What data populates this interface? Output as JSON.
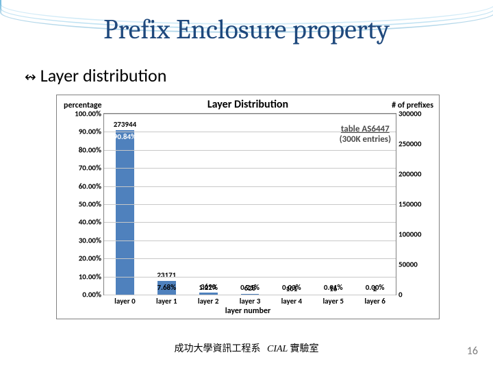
{
  "title": "Prefix Enclosure property",
  "bullet": "Layer distribution",
  "footer": {
    "org": "成功大學資訊工程系",
    "lab": "CIAL",
    "lab2": " 實驗室"
  },
  "page": "16",
  "chart_data": {
    "type": "bar",
    "title": "Layer Distribution",
    "xlabel": "layer number",
    "ylabel_left": "percentage",
    "ylabel_right": "# of prefixes",
    "note_line1": "table AS6447",
    "note_line2": "(300K entries)",
    "categories": [
      "layer 0",
      "layer 1",
      "layer 2",
      "layer 3",
      "layer 4",
      "layer 5",
      "layer 6"
    ],
    "series": [
      {
        "name": "percentage",
        "axis": "left",
        "values": [
          90.84,
          7.68,
          1.22,
          0.21,
          0.03,
          0.01,
          0.0
        ],
        "labels": [
          "90.84%",
          "7.68%",
          "1.22%",
          "0.21%",
          "0.03%",
          "0.01%",
          "0.00%"
        ]
      },
      {
        "name": "# of prefixes",
        "axis": "right",
        "values": [
          273944,
          23171,
          3690,
          628,
          101,
          16,
          2
        ],
        "labels": [
          "273944",
          "23171",
          "3690",
          "628",
          "101",
          "16",
          "2"
        ]
      }
    ],
    "y_left": {
      "min": 0,
      "max": 100,
      "step": 10,
      "ticks": [
        "0.00%",
        "10.00%",
        "20.00%",
        "30.00%",
        "40.00%",
        "50.00%",
        "60.00%",
        "70.00%",
        "80.00%",
        "90.00%",
        "100.00%"
      ]
    },
    "y_right": {
      "min": 0,
      "max": 300000,
      "step": 50000,
      "ticks": [
        "0",
        "50000",
        "100000",
        "150000",
        "200000",
        "250000",
        "300000"
      ]
    }
  }
}
